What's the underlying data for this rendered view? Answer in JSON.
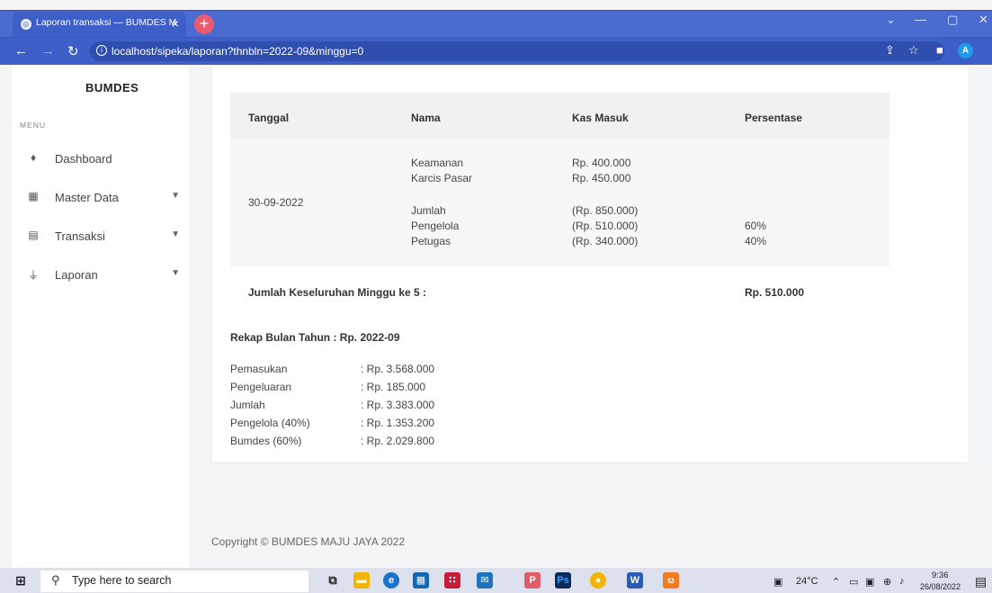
{
  "browser": {
    "tab_title": "Laporan transaksi — BUMDES M",
    "url": "localhost/sipeka/laporan?thnbln=2022-09&minggu=0"
  },
  "sidebar": {
    "brand": "BUMDES",
    "menu_label": "MENU",
    "items": [
      {
        "label": "Dashboard",
        "icon": "droplet-icon"
      },
      {
        "label": "Master Data",
        "icon": "grid-icon"
      },
      {
        "label": "Transaksi",
        "icon": "document-icon"
      },
      {
        "label": "Laporan",
        "icon": "plug-icon"
      }
    ]
  },
  "table": {
    "headers": [
      "Tanggal",
      "Nama",
      "Kas Masuk",
      "Persentase"
    ],
    "date": "30-09-2022",
    "income_items": [
      {
        "name": "Keamanan",
        "amount": "Rp. 400.000"
      },
      {
        "name": "Karcis Pasar",
        "amount": "Rp. 450.000"
      }
    ],
    "summary_items": [
      {
        "name": "Jumlah",
        "amount": "(Rp. 850.000)",
        "percent": ""
      },
      {
        "name": "Pengelola",
        "amount": "(Rp. 510.000)",
        "percent": "60%"
      },
      {
        "name": "Petugas",
        "amount": "(Rp. 340.000)",
        "percent": "40%"
      }
    ]
  },
  "week_total": {
    "label": "Jumlah Keseluruhan Minggu ke 5 :",
    "value": "Rp. 510.000"
  },
  "recap": {
    "title": "Rekap Bulan Tahun : Rp. 2022-09",
    "rows": [
      {
        "label": "Pemasukan",
        "value": ": Rp. 3.568.000"
      },
      {
        "label": "Pengeluaran",
        "value": ": Rp. 185.000"
      },
      {
        "label": "Jumlah",
        "value": ": Rp. 3.383.000"
      },
      {
        "label": "Pengelola (40%)",
        "value": ": Rp. 1.353.200"
      },
      {
        "label": "Bumdes (60%)",
        "value": ": Rp. 2.029.800"
      }
    ]
  },
  "footer": "Copyright © BUMDES MAJU JAYA 2022",
  "taskbar": {
    "search_placeholder": "Type here to search",
    "weather": "24°C",
    "time": "9:36",
    "date": "26/08/2022"
  }
}
